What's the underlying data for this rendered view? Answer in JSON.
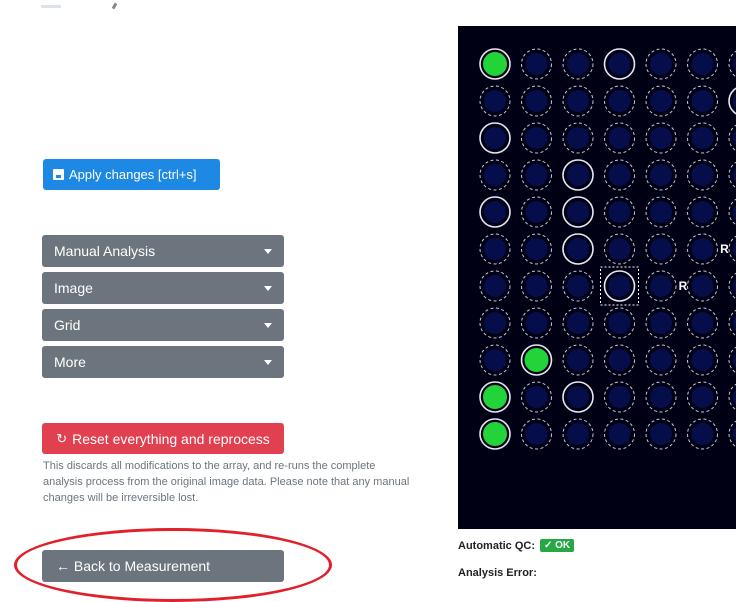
{
  "toolbar": {
    "apply_label": "Apply changes [ctrl+s]"
  },
  "menus": [
    {
      "label": "Manual Analysis"
    },
    {
      "label": "Image"
    },
    {
      "label": "Grid"
    },
    {
      "label": "More"
    }
  ],
  "reset": {
    "label": "Reset everything and reprocess",
    "note": "This discards all modifications to the array, and re-runs the complete analysis process from the original image data. Please note that any manual changes will be irreversible lost."
  },
  "back": {
    "label": "← Back to Measurement"
  },
  "array": {
    "reference_label": "R",
    "spots": [
      [
        {
          "s": "green-solid"
        },
        {
          "s": "dashed"
        },
        {
          "s": "dashed"
        },
        {
          "s": "solid"
        },
        {
          "s": "dashed"
        },
        {
          "s": "dashed"
        },
        {
          "s": "dashed"
        }
      ],
      [
        {
          "s": "dashed"
        },
        {
          "s": "dashed"
        },
        {
          "s": "dashed"
        },
        {
          "s": "dashed"
        },
        {
          "s": "dashed"
        },
        {
          "s": "dashed"
        },
        {
          "s": "solid"
        }
      ],
      [
        {
          "s": "solid"
        },
        {
          "s": "dashed"
        },
        {
          "s": "dashed"
        },
        {
          "s": "dashed"
        },
        {
          "s": "dashed"
        },
        {
          "s": "dashed"
        },
        {
          "s": "dashed"
        }
      ],
      [
        {
          "s": "dashed"
        },
        {
          "s": "dashed"
        },
        {
          "s": "solid"
        },
        {
          "s": "dashed"
        },
        {
          "s": "dashed"
        },
        {
          "s": "dashed"
        },
        {
          "s": "dashed"
        }
      ],
      [
        {
          "s": "solid"
        },
        {
          "s": "dashed"
        },
        {
          "s": "solid"
        },
        {
          "s": "dashed"
        },
        {
          "s": "dashed"
        },
        {
          "s": "dashed"
        },
        {
          "s": "dashed"
        }
      ],
      [
        {
          "s": "dashed"
        },
        {
          "s": "dashed"
        },
        {
          "s": "solid"
        },
        {
          "s": "dashed"
        },
        {
          "s": "dashed"
        },
        {
          "s": "ref"
        },
        {
          "s": "dashed"
        }
      ],
      [
        {
          "s": "dashed"
        },
        {
          "s": "dashed"
        },
        {
          "s": "dashed"
        },
        {
          "s": "selected"
        },
        {
          "s": "ref"
        },
        {
          "s": "dashed"
        },
        {
          "s": "dashed"
        }
      ],
      [
        {
          "s": "dashed"
        },
        {
          "s": "dashed"
        },
        {
          "s": "dashed"
        },
        {
          "s": "dashed"
        },
        {
          "s": "dashed"
        },
        {
          "s": "dashed"
        },
        {
          "s": "dashed"
        }
      ],
      [
        {
          "s": "dashed"
        },
        {
          "s": "green-solid"
        },
        {
          "s": "dashed"
        },
        {
          "s": "dashed"
        },
        {
          "s": "dashed"
        },
        {
          "s": "dashed"
        },
        {
          "s": "dashed"
        }
      ],
      [
        {
          "s": "green-solid"
        },
        {
          "s": "dashed"
        },
        {
          "s": "solid"
        },
        {
          "s": "dashed"
        },
        {
          "s": "dashed"
        },
        {
          "s": "dashed"
        },
        {
          "s": "dashed"
        }
      ],
      [
        {
          "s": "green-solid"
        },
        {
          "s": "dashed"
        },
        {
          "s": "dashed"
        },
        {
          "s": "dashed"
        },
        {
          "s": "dashed"
        },
        {
          "s": "dashed"
        },
        {
          "s": "dashed"
        }
      ]
    ]
  },
  "qc": {
    "label": "Automatic QC:",
    "badge": "✓ OK",
    "badge_color": "#28a745"
  },
  "error": {
    "label": "Analysis Error:"
  },
  "colors": {
    "primary": "#1e88e5",
    "danger": "#e04050",
    "secondary": "#6c757d",
    "highlight": "#e1202a"
  }
}
